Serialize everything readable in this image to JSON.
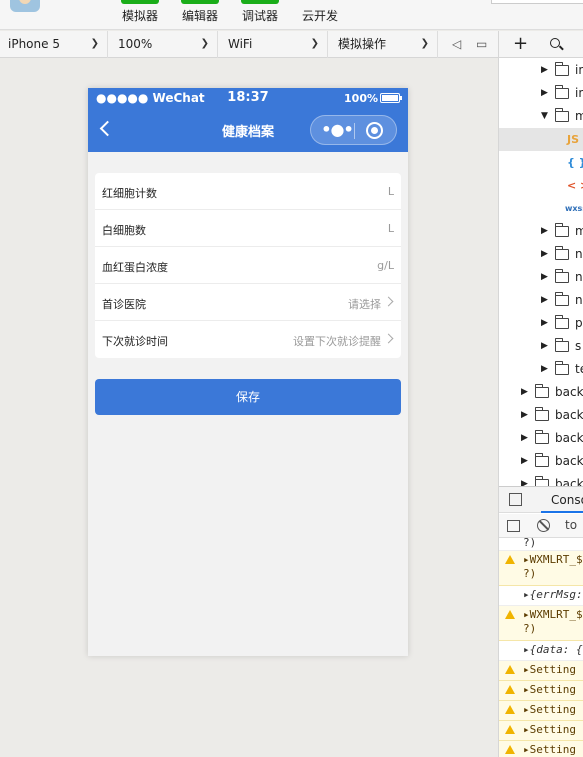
{
  "toolbar": {
    "tools": [
      {
        "label": "模拟器"
      },
      {
        "label": "编辑器"
      },
      {
        "label": "调试器"
      },
      {
        "label": "云开发"
      }
    ]
  },
  "device_bar": {
    "device": "iPhone 5",
    "zoom": "100%",
    "network": "WiFi",
    "operation": "模拟操作"
  },
  "phone": {
    "status": {
      "carrier": "●●●●● WeChat",
      "time": "18:37",
      "battery": "100%"
    },
    "nav_title": "健康档案",
    "capsule_dots": "•●•",
    "form_rows": [
      {
        "label": "红细胞计数",
        "value": "L",
        "arrow": false
      },
      {
        "label": "白细胞数",
        "value": "L",
        "arrow": false
      },
      {
        "label": "血红蛋白浓度",
        "value": "g/L",
        "arrow": false
      },
      {
        "label": "首诊医院",
        "value": "请选择",
        "arrow": true
      },
      {
        "label": "下次就诊时间",
        "value": "设置下次就诊提醒",
        "arrow": true
      }
    ],
    "save_label": "保存",
    "accent": "#3b78d8"
  },
  "devtools": {
    "tree": [
      {
        "name": "in",
        "arrow": "▶",
        "type": "folder"
      },
      {
        "name": "in",
        "arrow": "▶",
        "type": "folder"
      },
      {
        "name": "m",
        "arrow": "▼",
        "type": "folder-open"
      },
      {
        "name": "JS",
        "arrow": "",
        "type": "js",
        "selected": true
      },
      {
        "name": "{ }",
        "arrow": "",
        "type": "json"
      },
      {
        "name": "< >",
        "arrow": "",
        "type": "wxml"
      },
      {
        "name": "wxss",
        "arrow": "",
        "type": "wxss"
      },
      {
        "name": "m",
        "arrow": "▶",
        "type": "folder"
      },
      {
        "name": "n",
        "arrow": "▶",
        "type": "folder"
      },
      {
        "name": "n",
        "arrow": "▶",
        "type": "folder"
      },
      {
        "name": "n",
        "arrow": "▶",
        "type": "folder"
      },
      {
        "name": "p",
        "arrow": "▶",
        "type": "folder"
      },
      {
        "name": "s",
        "arrow": "▶",
        "type": "folder"
      },
      {
        "name": "te",
        "arrow": "▶",
        "type": "folder"
      },
      {
        "name": "backs",
        "arrow": "▶",
        "type": "root"
      },
      {
        "name": "backs",
        "arrow": "▶",
        "type": "root"
      },
      {
        "name": "backs",
        "arrow": "▶",
        "type": "root"
      },
      {
        "name": "backs",
        "arrow": "▶",
        "type": "root"
      },
      {
        "name": "backs",
        "arrow": "▶",
        "type": "root"
      }
    ],
    "console_tab": "Conso",
    "context": "to",
    "logs": [
      {
        "kind": "plain",
        "line1": "?)",
        "line2": ""
      },
      {
        "kind": "warn",
        "line1": "▸WXMLRT_$",
        "line2": "?)"
      },
      {
        "kind": "plain",
        "line1": "▸{errMsg:",
        "line2": ""
      },
      {
        "kind": "warn",
        "line1": "▸WXMLRT_$",
        "line2": "?)"
      },
      {
        "kind": "plain",
        "line1": "▸{data: {",
        "line2": ""
      },
      {
        "kind": "warn",
        "line1": "▸Setting",
        "line2": ""
      },
      {
        "kind": "warn",
        "line1": "▸Setting",
        "line2": ""
      },
      {
        "kind": "warn",
        "line1": "▸Setting",
        "line2": ""
      },
      {
        "kind": "warn",
        "line1": "▸Setting",
        "line2": ""
      },
      {
        "kind": "warn",
        "line1": "▸Setting",
        "line2": ""
      }
    ]
  }
}
